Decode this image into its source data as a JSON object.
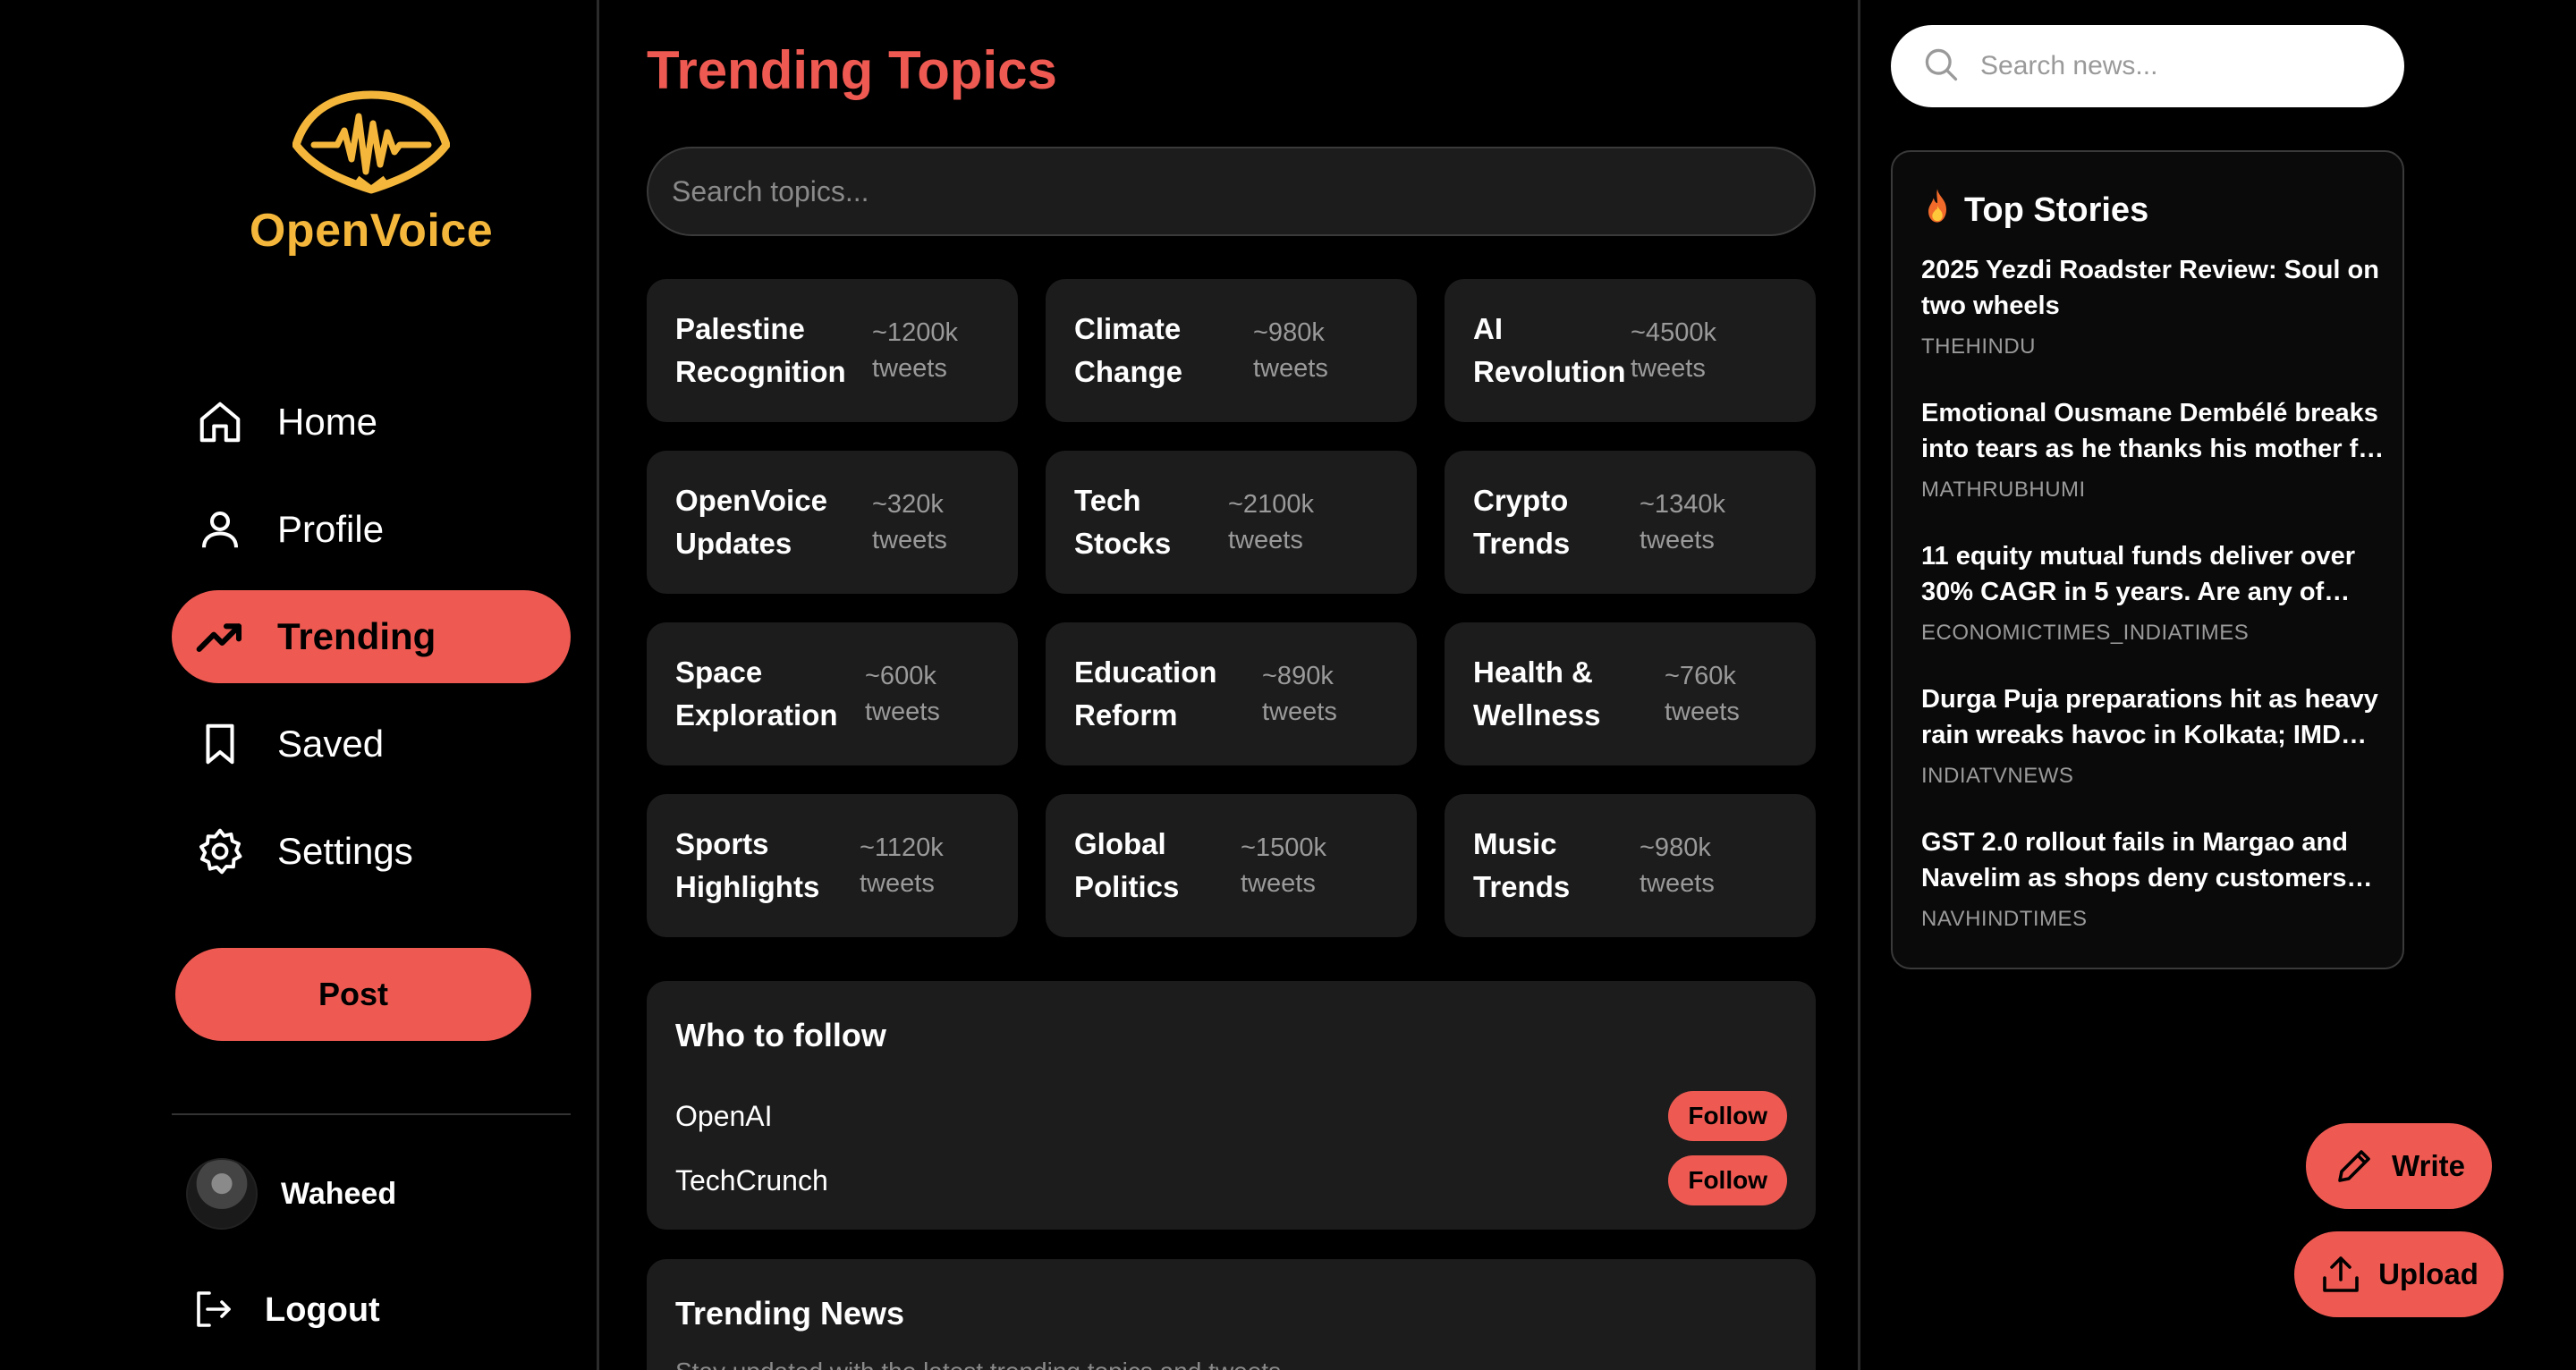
{
  "brand": {
    "name": "OpenVoice",
    "color": "#f4b73b",
    "icon": "soundwave-logo"
  },
  "accent_color": "#ee5a52",
  "nav": {
    "items": [
      {
        "label": "Home",
        "icon": "home-icon",
        "active": false
      },
      {
        "label": "Profile",
        "icon": "user-icon",
        "active": false
      },
      {
        "label": "Trending",
        "icon": "trending-icon",
        "active": true
      },
      {
        "label": "Saved",
        "icon": "bookmark-icon",
        "active": false
      },
      {
        "label": "Settings",
        "icon": "gear-icon",
        "active": false
      }
    ],
    "post_label": "Post"
  },
  "user": {
    "name": "Waheed",
    "logout_label": "Logout"
  },
  "main": {
    "title": "Trending Topics",
    "search_placeholder": "Search topics...",
    "topics": [
      {
        "name": "Palestine Recognition",
        "count": "~1200k",
        "unit": "tweets"
      },
      {
        "name": "Climate Change",
        "count": "~980k",
        "unit": "tweets"
      },
      {
        "name": "AI Revolution",
        "count": "~4500k",
        "unit": "tweets"
      },
      {
        "name": "OpenVoice Updates",
        "count": "~320k",
        "unit": "tweets"
      },
      {
        "name": "Tech Stocks",
        "count": "~2100k",
        "unit": "tweets"
      },
      {
        "name": "Crypto Trends",
        "count": "~1340k",
        "unit": "tweets"
      },
      {
        "name": "Space Exploration",
        "count": "~600k",
        "unit": "tweets"
      },
      {
        "name": "Education Reform",
        "count": "~890k",
        "unit": "tweets"
      },
      {
        "name": "Health & Wellness",
        "count": "~760k",
        "unit": "tweets"
      },
      {
        "name": "Sports Highlights",
        "count": "~1120k",
        "unit": "tweets"
      },
      {
        "name": "Global Politics",
        "count": "~1500k",
        "unit": "tweets"
      },
      {
        "name": "Music Trends",
        "count": "~980k",
        "unit": "tweets"
      }
    ],
    "who_to_follow": {
      "title": "Who to follow",
      "accounts": [
        {
          "name": "OpenAI",
          "button": "Follow"
        },
        {
          "name": "TechCrunch",
          "button": "Follow"
        }
      ]
    },
    "trending_news": {
      "title": "Trending News",
      "subtitle": "Stay updated with the latest trending topics and tweets"
    }
  },
  "right": {
    "search_placeholder": "Search news...",
    "top_stories": {
      "title": "Top Stories",
      "icon": "fire-icon",
      "items": [
        {
          "title": "2025 Yezdi Roadster Review: Soul on two wheels",
          "source": "THEHINDU"
        },
        {
          "title": "Emotional Ousmane Dembélé breaks into tears as he thanks his mother for her support",
          "source": "MATHRUBHUMI"
        },
        {
          "title": "11 equity mutual funds deliver over 30% CAGR in 5 years. Are any of them in your portfolio?",
          "source": "ECONOMICTIMES_INDIATIMES"
        },
        {
          "title": "Durga Puja preparations hit as heavy rain wreaks havoc in Kolkata; IMD issues alert",
          "source": "INDIATVNEWS"
        },
        {
          "title": "GST 2.0 rollout fails in Margao and Navelim as shops deny customers benefits",
          "source": "NAVHINDTIMES"
        }
      ]
    },
    "write_label": "Write",
    "upload_label": "Upload"
  }
}
